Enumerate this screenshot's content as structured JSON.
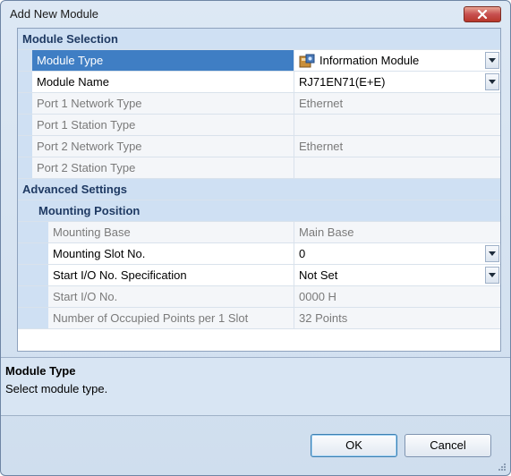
{
  "dialog": {
    "title": "Add New Module",
    "ok_label": "OK",
    "cancel_label": "Cancel"
  },
  "sections": {
    "module_selection": "Module Selection",
    "advanced_settings": "Advanced Settings",
    "mounting_position": "Mounting Position"
  },
  "properties": {
    "module_type": {
      "name": "Module Type",
      "value": "Information Module",
      "icon": "module-icon"
    },
    "module_name": {
      "name": "Module Name",
      "value": "RJ71EN71(E+E)"
    },
    "port1_network": {
      "name": "Port 1 Network Type",
      "value": "Ethernet"
    },
    "port1_station": {
      "name": "Port 1 Station Type",
      "value": ""
    },
    "port2_network": {
      "name": "Port 2 Network Type",
      "value": "Ethernet"
    },
    "port2_station": {
      "name": "Port 2 Station Type",
      "value": ""
    },
    "mounting_base": {
      "name": "Mounting Base",
      "value": "Main Base"
    },
    "mounting_slot": {
      "name": "Mounting Slot No.",
      "value": "0"
    },
    "start_io_spec": {
      "name": "Start I/O No. Specification",
      "value": "Not Set"
    },
    "start_io": {
      "name": "Start I/O No.",
      "value": "0000 H"
    },
    "occupied_points": {
      "name": "Number of Occupied Points per 1 Slot",
      "value": "32 Points"
    }
  },
  "description": {
    "title": "Module Type",
    "text": "Select module type."
  },
  "colors": {
    "selected_row": "#3f7ec4",
    "category_band": "#cfe0f3",
    "dialog_background": "#d6e3f1"
  }
}
